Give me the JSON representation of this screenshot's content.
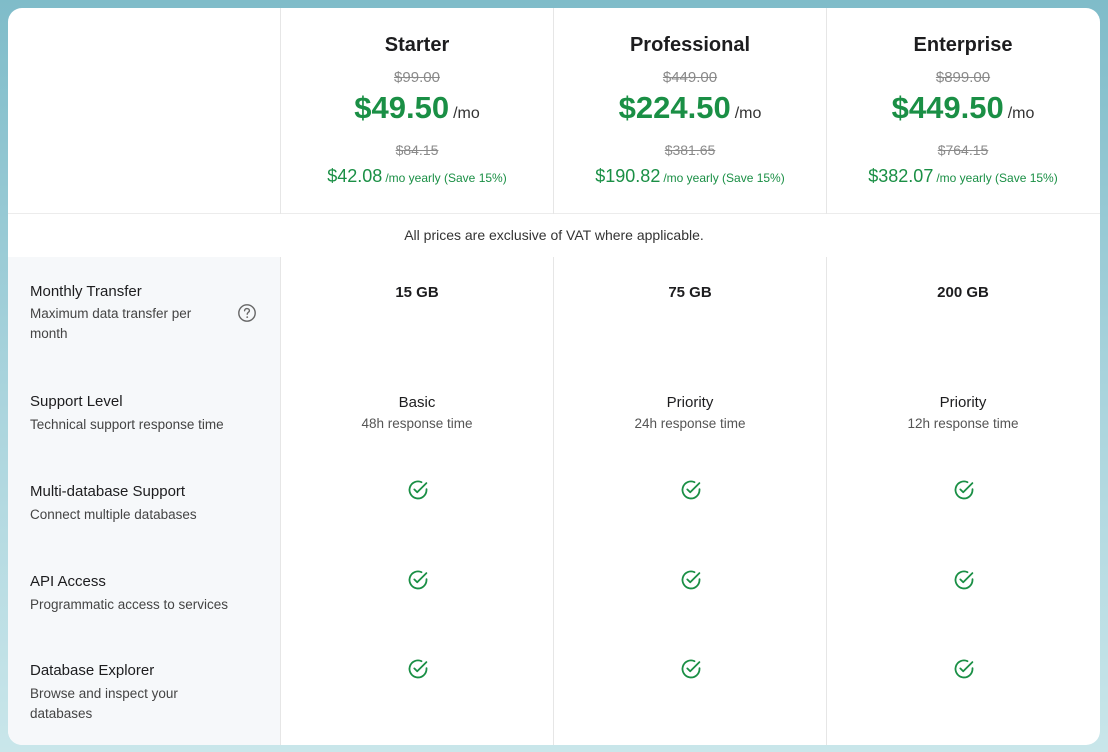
{
  "plans": [
    {
      "name": "Starter",
      "original_price": "$99.00",
      "price": "$49.50",
      "period": "/mo",
      "yearly_original": "$84.15",
      "yearly_price": "$42.08",
      "yearly_note": "/mo yearly (Save 15%)"
    },
    {
      "name": "Professional",
      "original_price": "$449.00",
      "price": "$224.50",
      "period": "/mo",
      "yearly_original": "$381.65",
      "yearly_price": "$190.82",
      "yearly_note": "/mo yearly (Save 15%)"
    },
    {
      "name": "Enterprise",
      "original_price": "$899.00",
      "price": "$449.50",
      "period": "/mo",
      "yearly_original": "$764.15",
      "yearly_price": "$382.07",
      "yearly_note": "/mo yearly (Save 15%)"
    }
  ],
  "vat_note": "All prices are exclusive of VAT where applicable.",
  "features": [
    {
      "title": "Monthly Transfer",
      "description": "Maximum data transfer per month",
      "has_help": true,
      "help_icon": "question-circle-icon"
    },
    {
      "title": "Support Level",
      "description": "Technical support response time"
    },
    {
      "title": "Multi-database Support",
      "description": "Connect multiple databases"
    },
    {
      "title": "API Access",
      "description": "Programmatic access to services"
    },
    {
      "title": "Database Explorer",
      "description": "Browse and inspect your databases"
    }
  ],
  "values": [
    {
      "transfer": "15 GB",
      "support_level": "Basic",
      "support_time": "48h response time",
      "multi_db": true,
      "api_access": true,
      "db_explorer": true
    },
    {
      "transfer": "75 GB",
      "support_level": "Priority",
      "support_time": "24h response time",
      "multi_db": true,
      "api_access": true,
      "db_explorer": true
    },
    {
      "transfer": "200 GB",
      "support_level": "Priority",
      "support_time": "12h response time",
      "multi_db": true,
      "api_access": true,
      "db_explorer": true
    }
  ],
  "icons": {
    "included": "check-circle-icon"
  },
  "colors": {
    "accent_green": "#1a8f45",
    "label_background": "#f6f8fa",
    "page_background": "#a8d3dc"
  }
}
